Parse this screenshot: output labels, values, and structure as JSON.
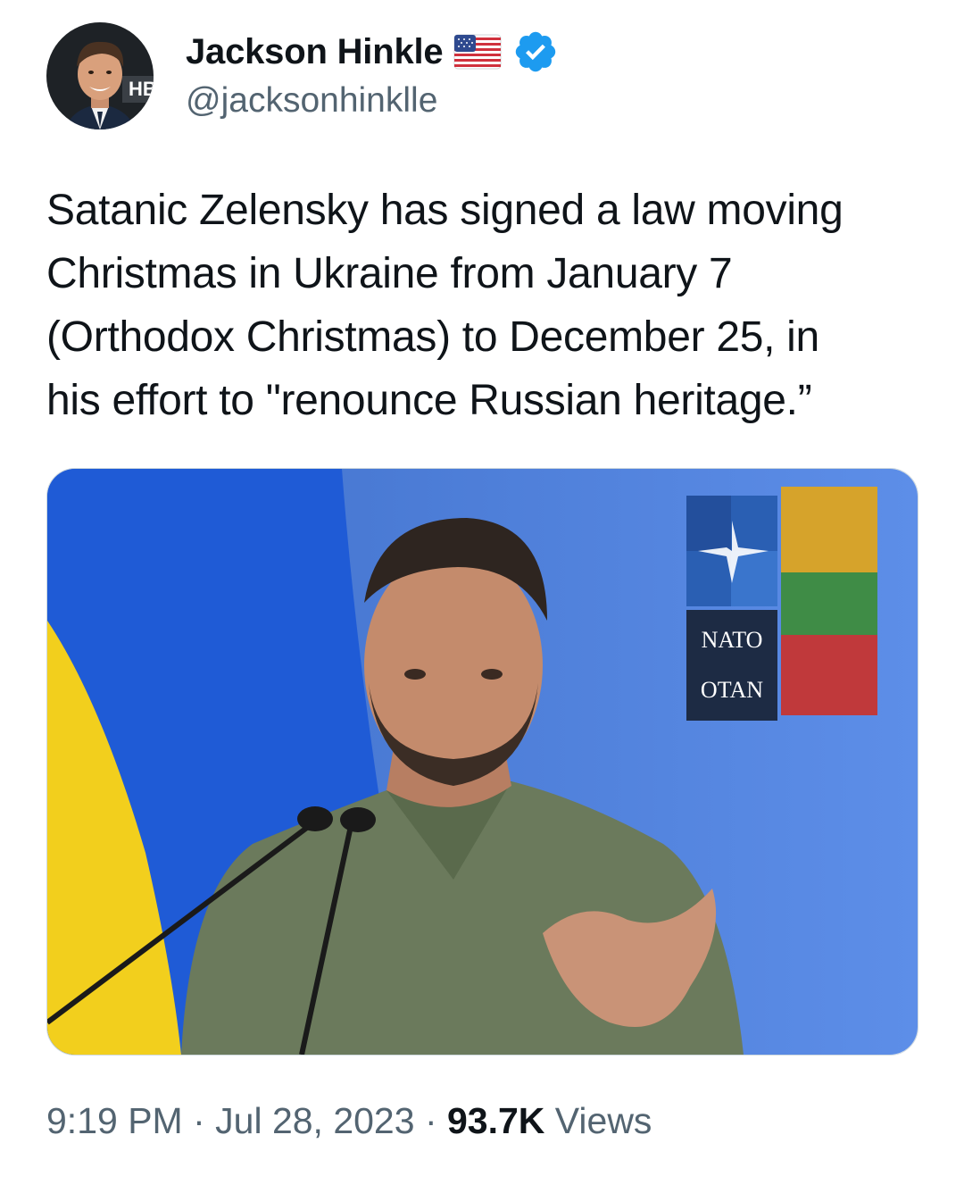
{
  "author": {
    "display_name": "Jackson Hinkle",
    "handle": "@jacksonhinklle",
    "avatar_icon": "profile-photo",
    "flag_icon": "us-flag-icon",
    "verified_icon": "verified-badge-icon",
    "verified_color": "#1d9bf0"
  },
  "tweet": {
    "text": "Satanic Zelensky has signed a law moving\nChristmas in Ukraine from January 7\n(Orthodox Christmas) to December 25, in\nhis effort to \"renounce Russian heritage.”"
  },
  "media": {
    "backdrop_sign_lines": [
      "NATO",
      "OTAN"
    ]
  },
  "meta": {
    "time": "9:19 PM",
    "separator": " · ",
    "date": "Jul 28, 2023",
    "views_count": "93.7K",
    "views_label": " Views"
  }
}
